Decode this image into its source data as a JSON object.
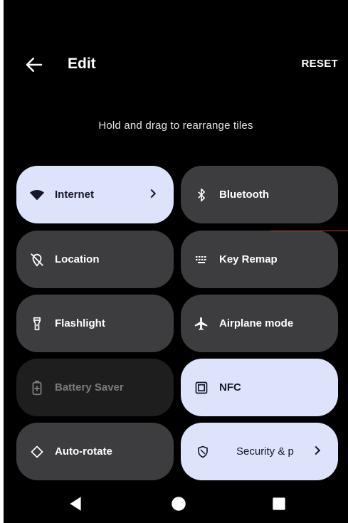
{
  "header": {
    "title": "Edit",
    "reset_label": "RESET"
  },
  "hint": "Hold and drag to rearrange tiles",
  "tiles": [
    {
      "label": "Internet",
      "icon": "wifi-icon",
      "state": "active",
      "has_chevron": true
    },
    {
      "label": "Bluetooth",
      "icon": "bluetooth-icon",
      "state": "inactive"
    },
    {
      "label": "Location",
      "icon": "location-off-icon",
      "state": "inactive"
    },
    {
      "label": "Key Remap",
      "icon": "keyboard-icon",
      "state": "inactive"
    },
    {
      "label": "Flashlight",
      "icon": "flashlight-icon",
      "state": "inactive"
    },
    {
      "label": "Airplane mode",
      "icon": "airplane-icon",
      "state": "inactive"
    },
    {
      "label": "Battery Saver",
      "icon": "battery-saver-icon",
      "state": "unavailable"
    },
    {
      "label": "NFC",
      "icon": "nfc-icon",
      "state": "active"
    },
    {
      "label": "Auto-rotate",
      "icon": "rotate-icon",
      "state": "inactive"
    },
    {
      "label": "Security & p",
      "icon": "shield-icon",
      "state": "active",
      "has_chevron": true
    }
  ],
  "colors": {
    "active_tile": "#dde3fb",
    "inactive_tile": "#3d3d40",
    "unavailable_tile": "#1e1e1f",
    "background": "#000000"
  }
}
